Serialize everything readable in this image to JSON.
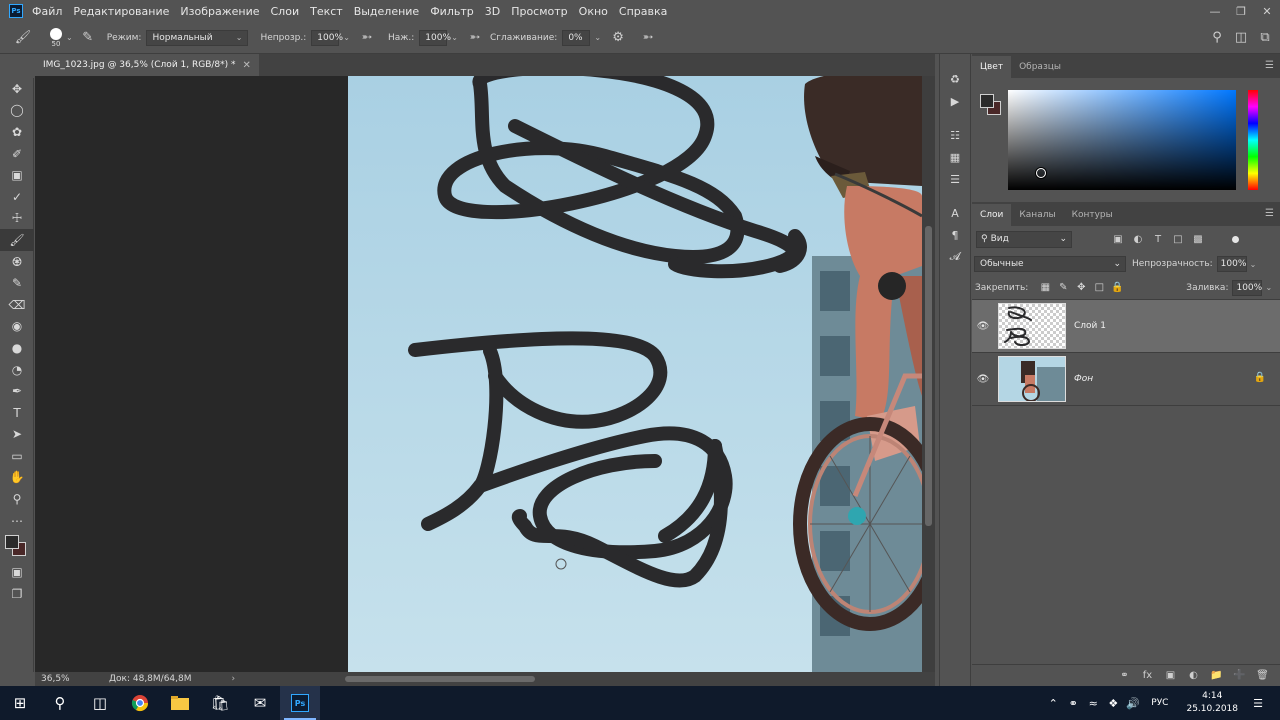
{
  "app": {
    "menu": [
      "Файл",
      "Редактирование",
      "Изображение",
      "Слои",
      "Текст",
      "Выделение",
      "Фильтр",
      "3D",
      "Просмотр",
      "Окно",
      "Справка"
    ],
    "logo": "Ps"
  },
  "options": {
    "brush_size": "50",
    "mode_label": "Режим:",
    "mode_value": "Нормальный",
    "opacity_label": "Непрозр.:",
    "opacity_value": "100%",
    "pressure_label": "Наж.:",
    "pressure_value": "100%",
    "smoothing_label": "Сглаживание:",
    "smoothing_value": "0%"
  },
  "document": {
    "tab_title": "IMG_1023.jpg @ 36,5% (Слой 1, RGB/8*) *",
    "zoom": "36,5%",
    "doc_info": "Док: 48,8M/64,8M",
    "canvas_bg": "#bcdbe7",
    "stroke_color": "#2a2a2c"
  },
  "tools": [
    "move-tool",
    "marquee-tool",
    "lasso-tool",
    "quick-selection-tool",
    "crop-tool",
    "eyedropper-tool",
    "healing-brush-tool",
    "brush-tool",
    "clone-stamp-tool",
    "history-brush-tool",
    "eraser-tool",
    "paint-bucket-tool",
    "blur-tool",
    "dodge-tool",
    "pen-tool",
    "type-tool",
    "path-selection-tool",
    "rectangle-tool",
    "hand-tool",
    "zoom-tool",
    "more-tools"
  ],
  "color_panel": {
    "tabs": [
      "Цвет",
      "Образцы"
    ],
    "foreground": "#2b2b2b",
    "background": "#4a2828",
    "hue_color": "#0077ff"
  },
  "layers_panel": {
    "tabs": [
      "Слои",
      "Каналы",
      "Контуры"
    ],
    "kind_filter": "Вид",
    "blend_mode": "Обычные",
    "opacity_label": "Непрозрачность:",
    "opacity_value": "100%",
    "lock_label": "Закрепить:",
    "fill_label": "Заливка:",
    "fill_value": "100%",
    "layers": [
      {
        "name": "Слой 1",
        "selected": true,
        "locked": false
      },
      {
        "name": "Фон",
        "selected": false,
        "locked": true
      }
    ]
  },
  "taskbar": {
    "lang": "РУС",
    "time": "4:14",
    "date": "25.10.2018"
  }
}
